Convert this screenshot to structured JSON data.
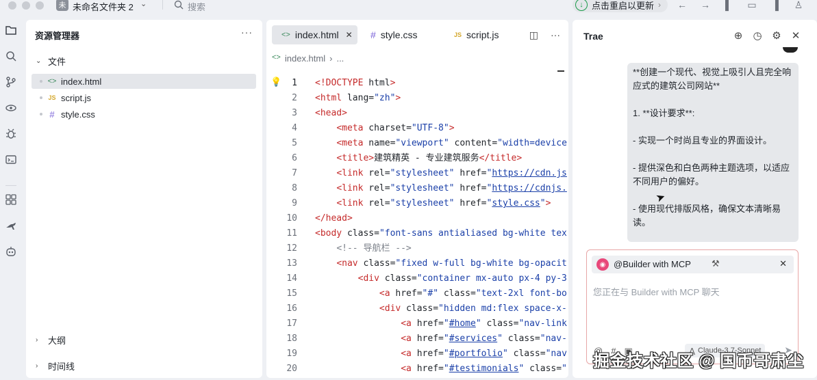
{
  "titlebar": {
    "project_badge": "未",
    "project_name": "未命名文件夹 2",
    "search_placeholder": "搜索",
    "update_label": "点击重启以更新",
    "icons": [
      "arrow-left-icon",
      "arrow-right-icon",
      "layout-left-icon",
      "layout-bottom-icon",
      "layout-right-icon",
      "account-icon"
    ]
  },
  "activity_bar": [
    "explorer-icon",
    "search-icon",
    "source-control-icon",
    "run-debug-icon",
    "bug-icon",
    "terminal-icon",
    "extensions-icon",
    "kangaroo-icon",
    "robot-icon"
  ],
  "explorer": {
    "title": "资源管理器",
    "more": "···",
    "section_files": "文件",
    "files": [
      {
        "name": "index.html",
        "icon": "<>",
        "type": "html"
      },
      {
        "name": "script.js",
        "icon": "JS",
        "type": "js"
      },
      {
        "name": "style.css",
        "icon": "#",
        "type": "css"
      }
    ],
    "section_outline": "大纲",
    "section_timeline": "时间线"
  },
  "editor": {
    "tabs": [
      {
        "label": "index.html",
        "icon": "<>",
        "close": "✕"
      },
      {
        "label": "style.css",
        "icon": "#"
      },
      {
        "label": "script.js",
        "icon": "JS"
      }
    ],
    "breadcrumb": {
      "icon": "<>",
      "file": "index.html",
      "sep": "›",
      "rest": "..."
    },
    "lines": [
      {
        "n": "1",
        "indent": "",
        "parts": [
          [
            "tg",
            "<!DOCTYPE"
          ],
          [
            "at",
            " html"
          ],
          [
            "tg",
            ">"
          ]
        ]
      },
      {
        "n": "2",
        "indent": "",
        "parts": [
          [
            "tg",
            "<html"
          ],
          [
            "at",
            " lang="
          ],
          [
            "st",
            "\"zh\""
          ],
          [
            "tg",
            ">"
          ]
        ]
      },
      {
        "n": "3",
        "indent": "",
        "parts": [
          [
            "tg",
            "<head>"
          ]
        ]
      },
      {
        "n": "4",
        "indent": "    ",
        "parts": [
          [
            "tg",
            "<meta"
          ],
          [
            "at",
            " charset="
          ],
          [
            "st",
            "\"UTF-8\""
          ],
          [
            "tg",
            ">"
          ]
        ]
      },
      {
        "n": "5",
        "indent": "    ",
        "parts": [
          [
            "tg",
            "<meta"
          ],
          [
            "at",
            " name="
          ],
          [
            "st",
            "\"viewport\""
          ],
          [
            "at",
            " content="
          ],
          [
            "st",
            "\"width=device"
          ]
        ]
      },
      {
        "n": "6",
        "indent": "    ",
        "parts": [
          [
            "tg",
            "<title>"
          ],
          [
            "at",
            "建筑精英 - 专业建筑服务"
          ],
          [
            "tg",
            "</title>"
          ]
        ]
      },
      {
        "n": "7",
        "indent": "    ",
        "parts": [
          [
            "tg",
            "<link"
          ],
          [
            "at",
            " rel="
          ],
          [
            "st",
            "\"stylesheet\""
          ],
          [
            "at",
            " href="
          ],
          [
            "st",
            "\""
          ],
          [
            "ul",
            "https://cdn.js"
          ]
        ]
      },
      {
        "n": "8",
        "indent": "    ",
        "parts": [
          [
            "tg",
            "<link"
          ],
          [
            "at",
            " rel="
          ],
          [
            "st",
            "\"stylesheet\""
          ],
          [
            "at",
            " href="
          ],
          [
            "st",
            "\""
          ],
          [
            "ul",
            "https://cdnjs."
          ]
        ]
      },
      {
        "n": "9",
        "indent": "    ",
        "parts": [
          [
            "tg",
            "<link"
          ],
          [
            "at",
            " rel="
          ],
          [
            "st",
            "\"stylesheet\""
          ],
          [
            "at",
            " href="
          ],
          [
            "st",
            "\""
          ],
          [
            "ul",
            "style.css"
          ],
          [
            "st",
            "\""
          ],
          [
            "tg",
            ">"
          ]
        ]
      },
      {
        "n": "10",
        "indent": "",
        "parts": [
          [
            "tg",
            "</head>"
          ]
        ]
      },
      {
        "n": "11",
        "indent": "",
        "parts": [
          [
            "tg",
            "<body"
          ],
          [
            "at",
            " class="
          ],
          [
            "st",
            "\"font-sans antialiased bg-white tex"
          ]
        ]
      },
      {
        "n": "12",
        "indent": "    ",
        "parts": [
          [
            "cm",
            "<!-- 导航栏 -->"
          ]
        ]
      },
      {
        "n": "13",
        "indent": "    ",
        "parts": [
          [
            "tg",
            "<nav"
          ],
          [
            "at",
            " class="
          ],
          [
            "st",
            "\"fixed w-full bg-white bg-opacit"
          ]
        ]
      },
      {
        "n": "14",
        "indent": "        ",
        "parts": [
          [
            "tg",
            "<div"
          ],
          [
            "at",
            " class="
          ],
          [
            "st",
            "\"container mx-auto px-4 py-3"
          ]
        ]
      },
      {
        "n": "15",
        "indent": "            ",
        "parts": [
          [
            "tg",
            "<a"
          ],
          [
            "at",
            " href="
          ],
          [
            "st",
            "\"#\""
          ],
          [
            "at",
            " class="
          ],
          [
            "st",
            "\"text-2xl font-bo"
          ]
        ]
      },
      {
        "n": "16",
        "indent": "            ",
        "parts": [
          [
            "tg",
            "<div"
          ],
          [
            "at",
            " class="
          ],
          [
            "st",
            "\"hidden md:flex space-x-"
          ]
        ]
      },
      {
        "n": "17",
        "indent": "                ",
        "parts": [
          [
            "tg",
            "<a"
          ],
          [
            "at",
            " href="
          ],
          [
            "st",
            "\""
          ],
          [
            "ul",
            "#home"
          ],
          [
            "st",
            "\""
          ],
          [
            "at",
            " class="
          ],
          [
            "st",
            "\"nav-link"
          ]
        ]
      },
      {
        "n": "18",
        "indent": "                ",
        "parts": [
          [
            "tg",
            "<a"
          ],
          [
            "at",
            " href="
          ],
          [
            "st",
            "\""
          ],
          [
            "ul",
            "#services"
          ],
          [
            "st",
            "\""
          ],
          [
            "at",
            " class="
          ],
          [
            "st",
            "\"nav-"
          ]
        ]
      },
      {
        "n": "19",
        "indent": "                ",
        "parts": [
          [
            "tg",
            "<a"
          ],
          [
            "at",
            " href="
          ],
          [
            "st",
            "\""
          ],
          [
            "ul",
            "#portfolio"
          ],
          [
            "st",
            "\""
          ],
          [
            "at",
            " class="
          ],
          [
            "st",
            "\"nav"
          ]
        ]
      },
      {
        "n": "20",
        "indent": "                ",
        "parts": [
          [
            "tg",
            "<a"
          ],
          [
            "at",
            " href="
          ],
          [
            "st",
            "\""
          ],
          [
            "ul",
            "#testimonials"
          ],
          [
            "st",
            "\""
          ],
          [
            "at",
            " class="
          ],
          [
            "st",
            "\""
          ]
        ]
      }
    ]
  },
  "chat": {
    "title": "Trae",
    "message": {
      "p1": "**创建一个现代、视觉上吸引人且完全响应式的建筑公司网站**",
      "p2": "1. **设计要求**:",
      "p3": "- 实现一个时尚且专业的界面设计。",
      "p4": "- 提供深色和白色两种主题选项，以适应不同用户的偏好。",
      "p5": "- 使用现代排版风格，确保文本清晰易读。"
    },
    "agent_name": "@Builder with MCP",
    "agent_close": "✕",
    "input_placeholder": "您正在与 Builder with MCP 聊天",
    "input_tools": [
      "@",
      "#",
      "▣"
    ],
    "model": "Claude-3.7-Sonnet",
    "watermark": "掘金技术社区 @ 国币哥肃尘"
  }
}
